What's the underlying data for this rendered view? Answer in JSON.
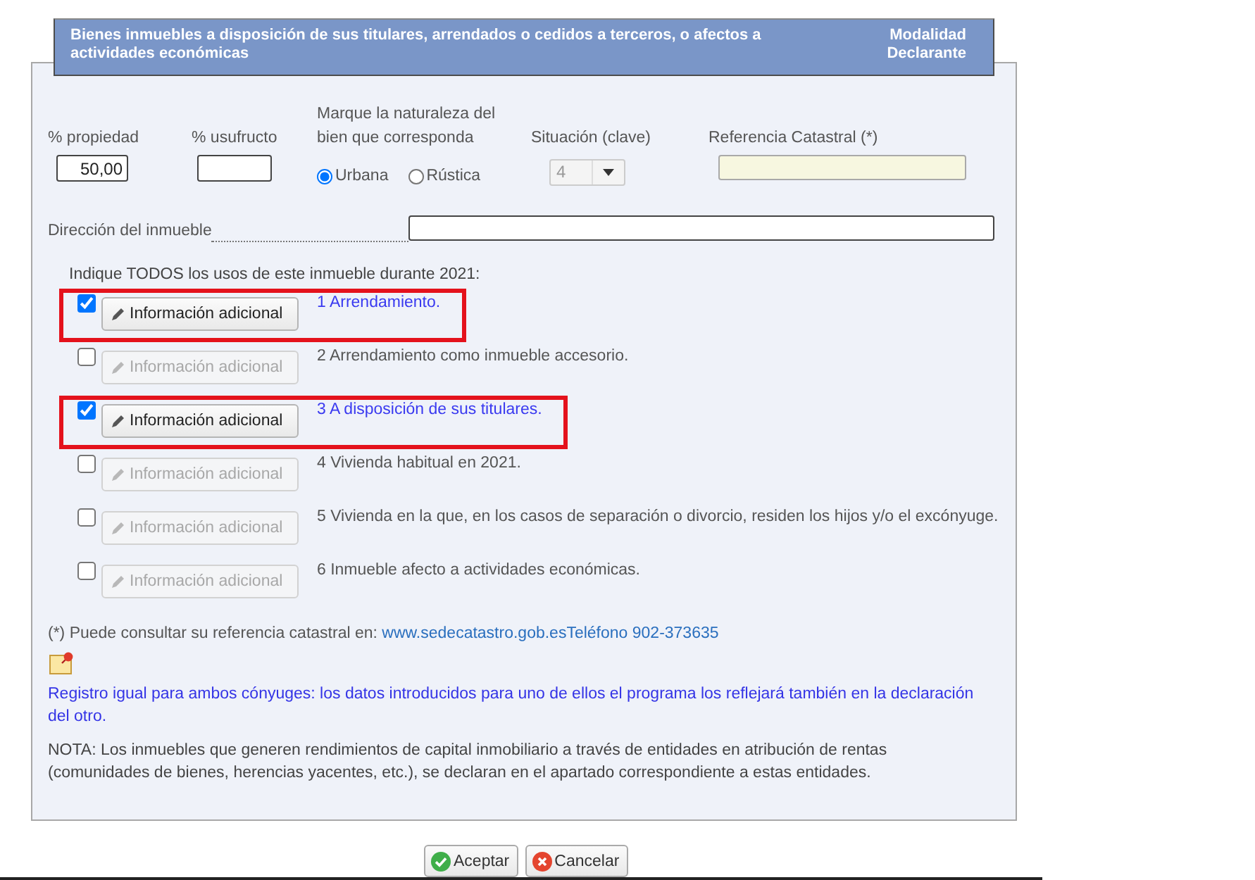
{
  "header": {
    "title": "Bienes inmuebles a disposición de sus titulares, arrendados o cedidos a terceros, o afectos a actividades económicas",
    "modalidad_label": "Modalidad",
    "modalidad_value": "Declarante"
  },
  "fields": {
    "propiedad": {
      "label": "% propiedad",
      "value": "50,00"
    },
    "usufructo": {
      "label": "% usufructo"
    },
    "naturaleza": {
      "label": "Marque la naturaleza del bien que corresponda",
      "options": [
        {
          "label": "Urbana",
          "selected": true
        },
        {
          "label": "Rústica",
          "selected": false
        }
      ]
    },
    "situacion": {
      "label": "Situación (clave)",
      "value": "4",
      "disabled": true
    },
    "referencia": {
      "label": "Referencia Catastral (*)"
    },
    "direccion": {
      "label": "Dirección del inmueble"
    }
  },
  "usos": {
    "prompt": "Indique TODOS los usos de este inmueble durante 2021:",
    "items": [
      {
        "button": "Información adicional",
        "label": "1 Arrendamiento.",
        "checked": true,
        "highlighted": true
      },
      {
        "button": "Información adicional",
        "label": "2 Arrendamiento como inmueble accesorio.",
        "checked": false,
        "highlighted": false
      },
      {
        "button": "Información adicional",
        "label": "3 A disposición de sus titulares.",
        "checked": true,
        "highlighted": true
      },
      {
        "button": "Información adicional",
        "label": "4 Vivienda habitual en 2021.",
        "checked": false,
        "highlighted": false
      },
      {
        "button": "Información adicional",
        "label": "5 Vivienda en la que, en los casos de separación o divorcio, residen los hijos y/o el excónyuge.",
        "checked": false,
        "highlighted": false
      },
      {
        "button": "Información adicional",
        "label": "6 Inmueble afecto a actividades económicas.",
        "checked": false,
        "highlighted": false
      }
    ]
  },
  "footnote": {
    "text": "(*) Puede consultar su referencia catastral en:",
    "link": "www.sedecatastro.gob.es",
    "phone": "Teléfono 902-373635"
  },
  "registro_note": "Registro igual para ambos cónyuges: los datos introducidos para uno de ellos el programa los reflejará también en la declaración del otro.",
  "nota": "NOTA: Los inmuebles que generen rendimientos de capital inmobiliario a través de entidades en atribución de rentas (comunidades de bienes, herencias yacentes, etc.), se declaran en el apartado correspondiente a estas entidades.",
  "buttons": [
    {
      "kind": "accept",
      "label": "Aceptar"
    },
    {
      "kind": "cancel",
      "label": "Cancelar"
    }
  ]
}
